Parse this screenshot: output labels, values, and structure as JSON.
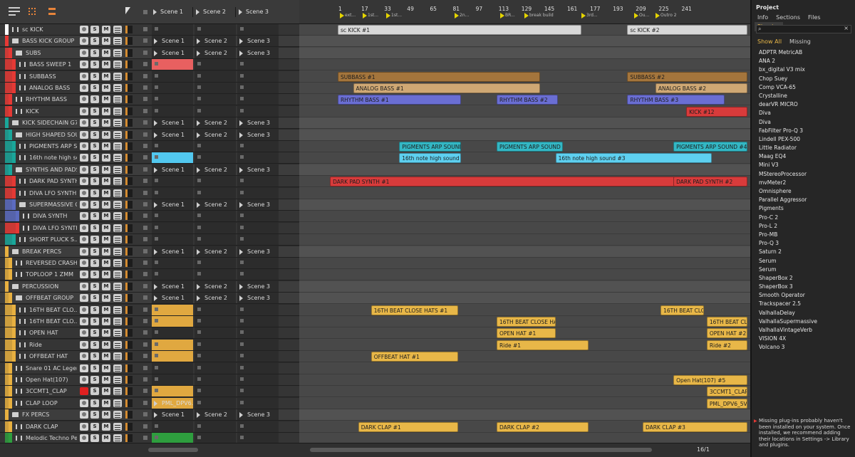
{
  "scenes": [
    "Scene 1",
    "Scene 2",
    "Scene 3"
  ],
  "ruler": {
    "bars": [
      "1",
      "17",
      "33",
      "49",
      "65",
      "81",
      "97",
      "113",
      "129",
      "145",
      "161",
      "177",
      "193",
      "209",
      "225",
      "241"
    ],
    "markers": [
      "ext...",
      "1st...",
      "1st...",
      "2n...",
      "BR...",
      "break build",
      "3rd...",
      "Ou...",
      "Outro 2"
    ]
  },
  "buttons": {
    "s": "S",
    "m": "M"
  },
  "tracks": [
    {
      "name": "sc KICK",
      "color": "#ffffff",
      "group": false,
      "indent": 0,
      "scenes": [
        "",
        "",
        ""
      ]
    },
    {
      "name": "BASS KICK GROUP",
      "color": "#e53935",
      "group": true,
      "indent": 0,
      "scenes": [
        "Scene 1",
        "Scene 2",
        "Scene 3"
      ]
    },
    {
      "name": "SUBS",
      "color": "#e53935",
      "group": true,
      "indent": 1,
      "scenes": [
        "Scene 1",
        "Scene 2",
        "Scene 3"
      ]
    },
    {
      "name": "BASS SWEEP 1",
      "color": "#e53935",
      "group": false,
      "indent": 2,
      "scenes": [
        "",
        "",
        ""
      ]
    },
    {
      "name": "SUBBASS",
      "color": "#e53935",
      "group": false,
      "indent": 2,
      "scenes": [
        "",
        "",
        ""
      ]
    },
    {
      "name": "ANALOG BASS",
      "color": "#e53935",
      "group": false,
      "indent": 2,
      "scenes": [
        "",
        "",
        ""
      ]
    },
    {
      "name": "RHYTHM BASS",
      "color": "#e53935",
      "group": false,
      "indent": 1,
      "scenes": [
        "",
        "",
        ""
      ]
    },
    {
      "name": "KICK",
      "color": "#e53935",
      "group": false,
      "indent": 1,
      "scenes": [
        "",
        "",
        ""
      ]
    },
    {
      "name": "KICK SIDECHAIN G7",
      "color": "#1aa69a",
      "group": true,
      "indent": 0,
      "scenes": [
        "Scene 1",
        "Scene 2",
        "Scene 3"
      ]
    },
    {
      "name": "HIGH SHAPED SOU...",
      "color": "#1aa69a",
      "group": true,
      "indent": 1,
      "scenes": [
        "Scene 1",
        "Scene 2",
        "Scene 3"
      ]
    },
    {
      "name": "PIGMENTS ARP S...",
      "color": "#1aa69a",
      "group": false,
      "indent": 2,
      "scenes": [
        "",
        "",
        ""
      ]
    },
    {
      "name": "16th note high sound",
      "color": "#1aa69a",
      "group": false,
      "indent": 2,
      "scenes": [
        "",
        "",
        ""
      ]
    },
    {
      "name": "SYNTHS AND PADS",
      "color": "#1aa69a",
      "group": true,
      "indent": 1,
      "scenes": [
        "Scene 1",
        "Scene 2",
        "Scene 3"
      ]
    },
    {
      "name": "DARK PAD SYNTH",
      "color": "#e53935",
      "group": false,
      "indent": 2,
      "scenes": [
        "",
        "",
        ""
      ]
    },
    {
      "name": "DIVA LFO SYNTH 2",
      "color": "#e53935",
      "group": false,
      "indent": 2,
      "scenes": [
        "",
        "",
        ""
      ]
    },
    {
      "name": "SUPERMASSIVE G...",
      "color": "#5c6bc0",
      "group": true,
      "indent": 2,
      "scenes": [
        "Scene 1",
        "Scene 2",
        "Scene 3"
      ]
    },
    {
      "name": "DIVA SYNTH",
      "color": "#5c6bc0",
      "group": false,
      "indent": 3,
      "scenes": [
        "",
        "",
        ""
      ]
    },
    {
      "name": "DIVA LFO SYNTH",
      "color": "#e53935",
      "group": false,
      "indent": 3,
      "scenes": [
        "",
        "",
        ""
      ]
    },
    {
      "name": "SHORT PLUCK S...",
      "color": "#1aa69a",
      "group": false,
      "indent": 2,
      "scenes": [
        "",
        "",
        ""
      ]
    },
    {
      "name": "BREAK PERCS",
      "color": "#e8b040",
      "group": true,
      "indent": 0,
      "scenes": [
        "Scene 1",
        "Scene 2",
        "Scene 3"
      ]
    },
    {
      "name": "REVERSED CRASH",
      "color": "#e8b040",
      "group": false,
      "indent": 1,
      "scenes": [
        "",
        "",
        ""
      ]
    },
    {
      "name": "TOPLOOP 1 ZMM",
      "color": "#e8b040",
      "group": false,
      "indent": 1,
      "scenes": [
        "",
        "",
        ""
      ]
    },
    {
      "name": "PERCUSSION",
      "color": "#e8b040",
      "group": true,
      "indent": 0,
      "scenes": [
        "Scene 1",
        "Scene 2",
        "Scene 3"
      ]
    },
    {
      "name": "OFFBEAT GROUP",
      "color": "#e8b040",
      "group": true,
      "indent": 1,
      "scenes": [
        "Scene 1",
        "Scene 2",
        "Scene 3"
      ]
    },
    {
      "name": "16TH BEAT CLO...",
      "color": "#e8b040",
      "group": false,
      "indent": 2,
      "scenes": [
        "",
        "",
        ""
      ]
    },
    {
      "name": "16TH BEAT CLO...",
      "color": "#e8b040",
      "group": false,
      "indent": 2,
      "scenes": [
        "",
        "",
        ""
      ]
    },
    {
      "name": "OPEN HAT",
      "color": "#e8b040",
      "group": false,
      "indent": 2,
      "scenes": [
        "",
        "",
        ""
      ]
    },
    {
      "name": "Ride",
      "color": "#e8b040",
      "group": false,
      "indent": 2,
      "scenes": [
        "",
        "",
        ""
      ]
    },
    {
      "name": "OFFBEAT HAT",
      "color": "#e8b040",
      "group": false,
      "indent": 2,
      "scenes": [
        "",
        "",
        ""
      ]
    },
    {
      "name": "Snare 01 AC Legen...",
      "color": "#e8b040",
      "group": false,
      "indent": 1,
      "scenes": [
        "",
        "",
        ""
      ]
    },
    {
      "name": "Open Hat(107)",
      "color": "#e8b040",
      "group": false,
      "indent": 1,
      "scenes": [
        "",
        "",
        ""
      ]
    },
    {
      "name": "3CCMT1_CLAP",
      "color": "#e8b040",
      "group": false,
      "indent": 1,
      "scenes": [
        "",
        "",
        ""
      ]
    },
    {
      "name": "CLAP LOOP",
      "color": "#e8b040",
      "group": false,
      "indent": 1,
      "scenes": [
        "PML_DPV6...",
        "",
        ""
      ]
    },
    {
      "name": "FX PERCS",
      "color": "#e8b040",
      "group": true,
      "indent": 0,
      "scenes": [
        "Scene 1",
        "Scene 2",
        "Scene 3"
      ]
    },
    {
      "name": "DARK CLAP",
      "color": "#e8b040",
      "group": false,
      "indent": 1,
      "scenes": [
        "",
        "",
        ""
      ]
    },
    {
      "name": "Melodic Techno Pe...",
      "color": "#2e9e3e",
      "group": false,
      "indent": 1,
      "scenes": [
        "",
        "",
        ""
      ]
    }
  ],
  "arranger_clips": [
    {
      "row": 0,
      "label": "sc KICK #1",
      "start": 7.5,
      "len": 47.5,
      "color": "#d8d8d8"
    },
    {
      "row": 0,
      "label": "sc KICK #2",
      "start": 64,
      "len": 23.5,
      "color": "#d8d8d8"
    },
    {
      "row": 4,
      "label": "SUBBASS #1",
      "start": 7.5,
      "len": 39.5,
      "color": "#a4753c"
    },
    {
      "row": 4,
      "label": "SUBBASS #2",
      "start": 64,
      "len": 23.5,
      "color": "#a4753c"
    },
    {
      "row": 5,
      "label": "ANALOG BASS #1",
      "start": 10.5,
      "len": 36.5,
      "color": "#cfa874"
    },
    {
      "row": 5,
      "label": "ANALOG BASS #2",
      "start": 69.5,
      "len": 18,
      "color": "#cfa874"
    },
    {
      "row": 6,
      "label": "RHYTHM BASS #1",
      "start": 7.5,
      "len": 24,
      "color": "#6a6ed3"
    },
    {
      "row": 6,
      "label": "RHYTHM BASS #2",
      "start": 38.5,
      "len": 12,
      "color": "#6a6ed3"
    },
    {
      "row": 6,
      "label": "RHYTHM BASS #3",
      "start": 64,
      "len": 19,
      "color": "#6a6ed3"
    },
    {
      "row": 7,
      "label": "KICK #12",
      "start": 75.5,
      "len": 12,
      "color": "#d83b3b"
    },
    {
      "row": 10,
      "label": "PIGMENTS ARP SOUND #2",
      "start": 19.5,
      "len": 12,
      "color": "#33b7c4"
    },
    {
      "row": 10,
      "label": "PIGMENTS ARP SOUND #3",
      "start": 38.5,
      "len": 13,
      "color": "#33b7c4"
    },
    {
      "row": 10,
      "label": "PIGMENTS ARP SOUND #4",
      "start": 73,
      "len": 14.5,
      "color": "#33b7c4"
    },
    {
      "row": 11,
      "label": "16th note high sound",
      "start": 19.5,
      "len": 12,
      "color": "#5ed0f0"
    },
    {
      "row": 11,
      "label": "16th note high sound #3",
      "start": 50,
      "len": 30.5,
      "color": "#5ed0f0"
    },
    {
      "row": 13,
      "label": "DARK PAD SYNTH #1",
      "start": 6,
      "len": 71.5,
      "color": "#d83b3b"
    },
    {
      "row": 13,
      "label": "DARK PAD SYNTH #2",
      "start": 73,
      "len": 14.5,
      "color": "#d83b3b"
    },
    {
      "row": 24,
      "label": "16TH BEAT CLOSE HATS #1",
      "start": 14,
      "len": 17,
      "color": "#e8b748"
    },
    {
      "row": 24,
      "label": "16TH BEAT CLOSE HATS #2",
      "start": 70.5,
      "len": 8.5,
      "color": "#e8b748"
    },
    {
      "row": 25,
      "label": "16TH BEAT CLOSE HATS #3",
      "start": 38.5,
      "len": 11.5,
      "color": "#e8b748"
    },
    {
      "row": 25,
      "label": "16TH BEAT CLOSE HATS #4",
      "start": 79.5,
      "len": 8,
      "color": "#e8b748"
    },
    {
      "row": 26,
      "label": "OPEN HAT #1",
      "start": 38.5,
      "len": 11.5,
      "color": "#e8b748"
    },
    {
      "row": 26,
      "label": "OPEN HAT #2",
      "start": 79.5,
      "len": 8,
      "color": "#e8b748"
    },
    {
      "row": 27,
      "label": "Ride #1",
      "start": 38.5,
      "len": 18,
      "color": "#e8b748"
    },
    {
      "row": 27,
      "label": "Ride #2",
      "start": 79.5,
      "len": 8,
      "color": "#e8b748"
    },
    {
      "row": 28,
      "label": "OFFBEAT HAT #1",
      "start": 14,
      "len": 17,
      "color": "#e8b748"
    },
    {
      "row": 30,
      "label": "Open Hat(107) #5",
      "start": 73,
      "len": 14.5,
      "color": "#e8b748"
    },
    {
      "row": 31,
      "label": "3CCMT1_CLAP #2",
      "start": 79.5,
      "len": 8,
      "color": "#e8b748"
    },
    {
      "row": 32,
      "label": "PML_DPV6_5V_Clap",
      "start": 79.5,
      "len": 8,
      "color": "#e8b748"
    },
    {
      "row": 34,
      "label": "DARK CLAP #1",
      "start": 11.5,
      "len": 19.5,
      "color": "#e8b748"
    },
    {
      "row": 34,
      "label": "DARK CLAP #2",
      "start": 38.5,
      "len": 18,
      "color": "#e8b748"
    },
    {
      "row": 34,
      "label": "DARK CLAP #3",
      "start": 67,
      "len": 20.5,
      "color": "#e8b748"
    }
  ],
  "browser": {
    "title": "Project",
    "tabs": [
      "Info",
      "Sections",
      "Files",
      "Plug-ins"
    ],
    "filters": [
      "Show All",
      "Missing"
    ],
    "plugins": [
      "ADPTR MetricAB",
      "ANA 2",
      "bx_digital V3 mix",
      "Chop Suey",
      "Comp VCA-65",
      "Crystalline",
      "dearVR MICRO",
      "Diva",
      "Diva",
      "FabFilter Pro-Q 3",
      "Lindell PEX-500",
      "Little Radiator",
      "Maag EQ4",
      "Mini V3",
      "MStereoProcessor",
      "mvMeter2",
      "Omnisphere",
      "Parallel Aggressor",
      "Pigments",
      "Pro-C 2",
      "Pro-L 2",
      "Pro-MB",
      "Pro-Q 3",
      "Saturn 2",
      "Serum",
      "Serum",
      "ShaperBox 2",
      "ShaperBox 3",
      "Smooth Operator",
      "Trackspacer 2.5",
      "ValhallaDelay",
      "ValhallaSupermassive",
      "ValhallaVintageVerb",
      "VISION 4X",
      "Volcano 3"
    ],
    "warning": "Missing plug-ins probably haven't been installed on your system. Once installed, we recommend adding their locations in Settings -> Library and plugins."
  },
  "footer": {
    "zoom": "16/1"
  },
  "colors": {
    "accent": "#e8b748",
    "bg": "#2b2b2b"
  }
}
